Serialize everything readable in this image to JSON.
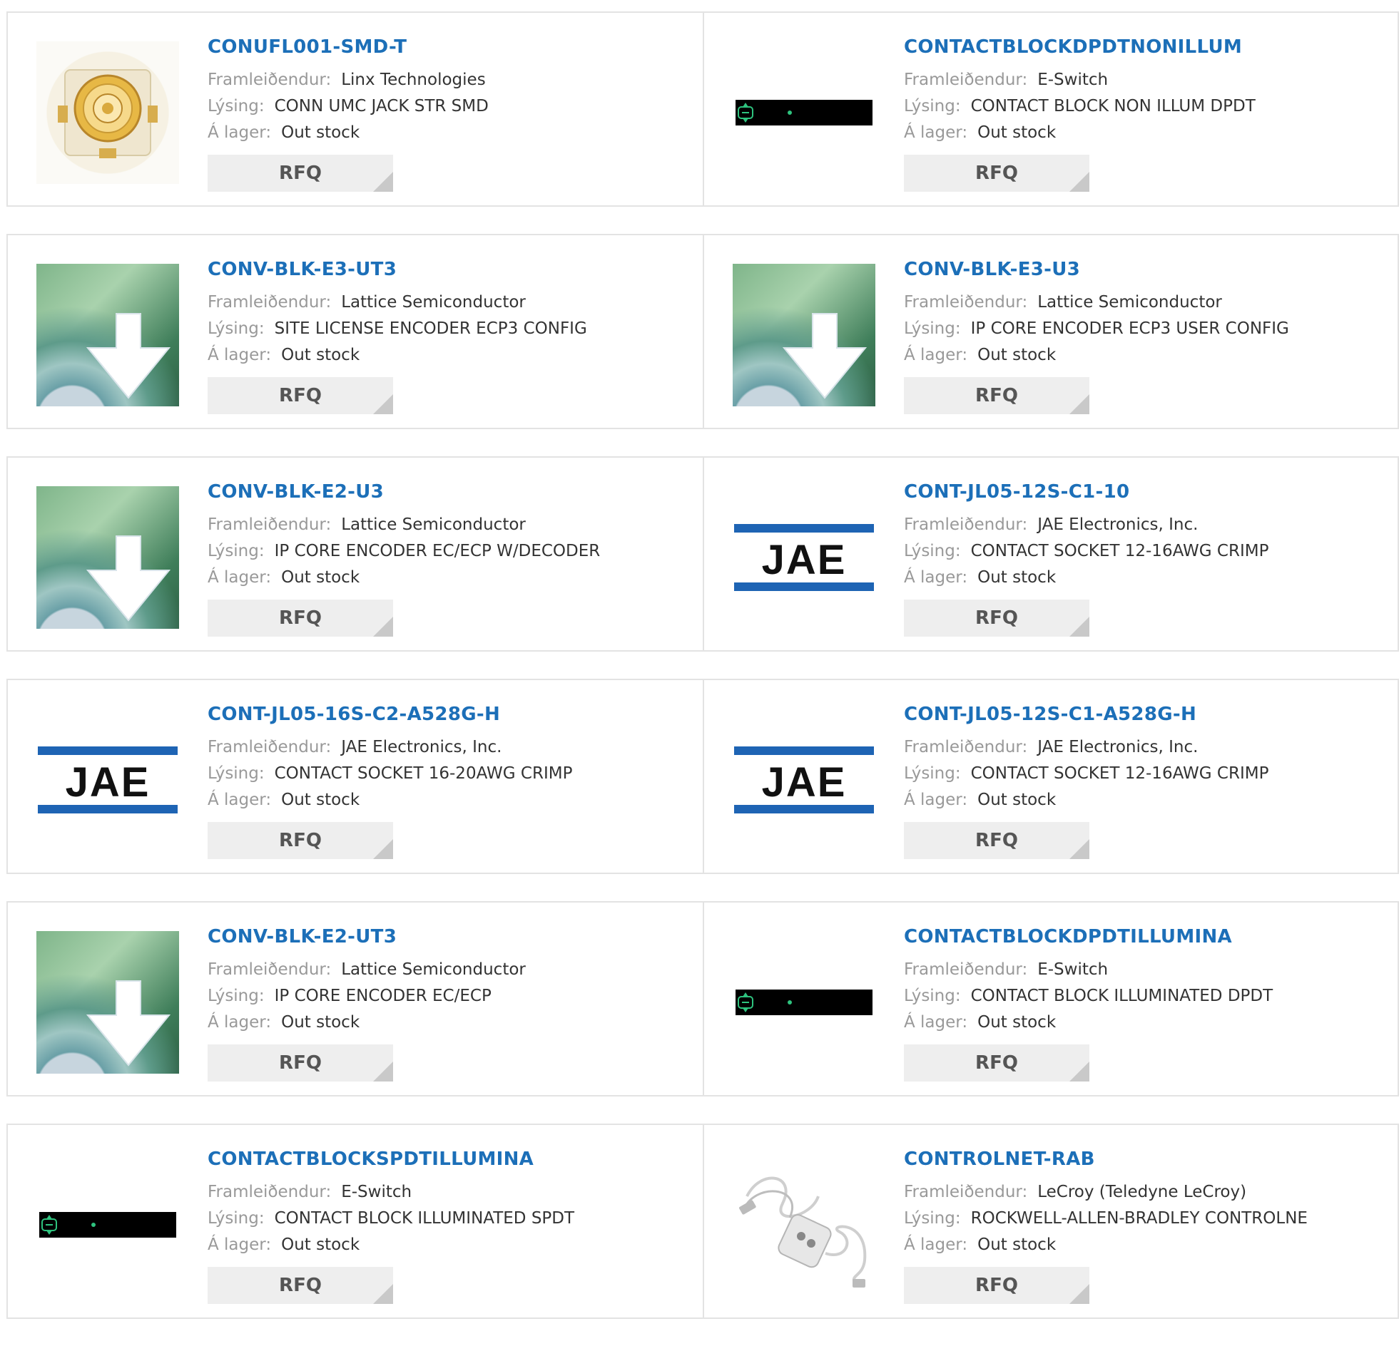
{
  "labels": {
    "manufacturer": "Framleiðendur:",
    "description": "Lýsing:",
    "stock": "Á lager:",
    "rfq": "RFQ"
  },
  "products": [
    {
      "part": "CONUFL001-SMD-T",
      "manufacturer": "Linx Technologies",
      "description": "CONN UMC JACK STR SMD",
      "stock": "Out stock",
      "image": "ufl-connector-icon"
    },
    {
      "part": "CONTACTBLOCKDPDTNONILLUM",
      "manufacturer": "E-Switch",
      "description": "CONTACT BLOCK NON ILLUM DPDT",
      "stock": "Out stock",
      "image": "switch-placeholder-icon"
    },
    {
      "part": "CONV-BLK-E3-UT3",
      "manufacturer": "Lattice Semiconductor",
      "description": "SITE LICENSE ENCODER ECP3 CONFIG",
      "stock": "Out stock",
      "image": "software-download-icon"
    },
    {
      "part": "CONV-BLK-E3-U3",
      "manufacturer": "Lattice Semiconductor",
      "description": "IP CORE ENCODER ECP3 USER CONFIG",
      "stock": "Out stock",
      "image": "software-download-icon"
    },
    {
      "part": "CONV-BLK-E2-U3",
      "manufacturer": "Lattice Semiconductor",
      "description": "IP CORE ENCODER EC/ECP W/DECODER",
      "stock": "Out stock",
      "image": "software-download-icon"
    },
    {
      "part": "CONT-JL05-12S-C1-10",
      "manufacturer": "JAE Electronics, Inc.",
      "description": "CONTACT SOCKET 12-16AWG CRIMP",
      "stock": "Out stock",
      "image": "jae-logo-icon"
    },
    {
      "part": "CONT-JL05-16S-C2-A528G-H",
      "manufacturer": "JAE Electronics, Inc.",
      "description": "CONTACT SOCKET 16-20AWG CRIMP",
      "stock": "Out stock",
      "image": "jae-logo-icon"
    },
    {
      "part": "CONT-JL05-12S-C1-A528G-H",
      "manufacturer": "JAE Electronics, Inc.",
      "description": "CONTACT SOCKET 12-16AWG CRIMP",
      "stock": "Out stock",
      "image": "jae-logo-icon"
    },
    {
      "part": "CONV-BLK-E2-UT3",
      "manufacturer": "Lattice Semiconductor",
      "description": "IP CORE ENCODER EC/ECP",
      "stock": "Out stock",
      "image": "software-download-icon"
    },
    {
      "part": "CONTACTBLOCKDPDTILLUMINA",
      "manufacturer": "E-Switch",
      "description": "CONTACT BLOCK ILLUMINATED DPDT",
      "stock": "Out stock",
      "image": "switch-placeholder-icon"
    },
    {
      "part": "CONTACTBLOCKSPDTILLUMINA",
      "manufacturer": "E-Switch",
      "description": "CONTACT BLOCK ILLUMINATED SPDT",
      "stock": "Out stock",
      "image": "switch-placeholder-icon"
    },
    {
      "part": "CONTROLNET-RAB",
      "manufacturer": "LeCroy (Teledyne LeCroy)",
      "description": "ROCKWELL-ALLEN-BRADLEY CONTROLNE",
      "stock": "Out stock",
      "image": "usb-cable-adapter-icon"
    }
  ],
  "colors": {
    "title_link": "#1c6fb8",
    "label": "#999999",
    "value": "#333333",
    "rfq_bg": "#eeeeee",
    "border": "#e3e3e3",
    "jae_blue": "#1e64b4"
  }
}
